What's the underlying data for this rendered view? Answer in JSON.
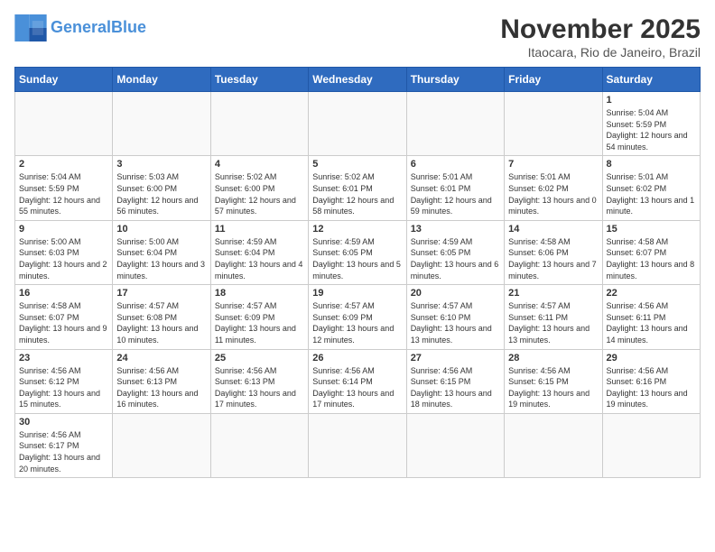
{
  "logo": {
    "text_general": "General",
    "text_blue": "Blue"
  },
  "calendar": {
    "title": "November 2025",
    "subtitle": "Itaocara, Rio de Janeiro, Brazil",
    "headers": [
      "Sunday",
      "Monday",
      "Tuesday",
      "Wednesday",
      "Thursday",
      "Friday",
      "Saturday"
    ],
    "days": [
      {
        "num": "",
        "info": ""
      },
      {
        "num": "",
        "info": ""
      },
      {
        "num": "",
        "info": ""
      },
      {
        "num": "",
        "info": ""
      },
      {
        "num": "",
        "info": ""
      },
      {
        "num": "",
        "info": ""
      },
      {
        "num": "1",
        "info": "Sunrise: 5:04 AM\nSunset: 5:59 PM\nDaylight: 12 hours and 54 minutes."
      },
      {
        "num": "2",
        "info": "Sunrise: 5:04 AM\nSunset: 5:59 PM\nDaylight: 12 hours and 55 minutes."
      },
      {
        "num": "3",
        "info": "Sunrise: 5:03 AM\nSunset: 6:00 PM\nDaylight: 12 hours and 56 minutes."
      },
      {
        "num": "4",
        "info": "Sunrise: 5:02 AM\nSunset: 6:00 PM\nDaylight: 12 hours and 57 minutes."
      },
      {
        "num": "5",
        "info": "Sunrise: 5:02 AM\nSunset: 6:01 PM\nDaylight: 12 hours and 58 minutes."
      },
      {
        "num": "6",
        "info": "Sunrise: 5:01 AM\nSunset: 6:01 PM\nDaylight: 12 hours and 59 minutes."
      },
      {
        "num": "7",
        "info": "Sunrise: 5:01 AM\nSunset: 6:02 PM\nDaylight: 13 hours and 0 minutes."
      },
      {
        "num": "8",
        "info": "Sunrise: 5:01 AM\nSunset: 6:02 PM\nDaylight: 13 hours and 1 minute."
      },
      {
        "num": "9",
        "info": "Sunrise: 5:00 AM\nSunset: 6:03 PM\nDaylight: 13 hours and 2 minutes."
      },
      {
        "num": "10",
        "info": "Sunrise: 5:00 AM\nSunset: 6:04 PM\nDaylight: 13 hours and 3 minutes."
      },
      {
        "num": "11",
        "info": "Sunrise: 4:59 AM\nSunset: 6:04 PM\nDaylight: 13 hours and 4 minutes."
      },
      {
        "num": "12",
        "info": "Sunrise: 4:59 AM\nSunset: 6:05 PM\nDaylight: 13 hours and 5 minutes."
      },
      {
        "num": "13",
        "info": "Sunrise: 4:59 AM\nSunset: 6:05 PM\nDaylight: 13 hours and 6 minutes."
      },
      {
        "num": "14",
        "info": "Sunrise: 4:58 AM\nSunset: 6:06 PM\nDaylight: 13 hours and 7 minutes."
      },
      {
        "num": "15",
        "info": "Sunrise: 4:58 AM\nSunset: 6:07 PM\nDaylight: 13 hours and 8 minutes."
      },
      {
        "num": "16",
        "info": "Sunrise: 4:58 AM\nSunset: 6:07 PM\nDaylight: 13 hours and 9 minutes."
      },
      {
        "num": "17",
        "info": "Sunrise: 4:57 AM\nSunset: 6:08 PM\nDaylight: 13 hours and 10 minutes."
      },
      {
        "num": "18",
        "info": "Sunrise: 4:57 AM\nSunset: 6:09 PM\nDaylight: 13 hours and 11 minutes."
      },
      {
        "num": "19",
        "info": "Sunrise: 4:57 AM\nSunset: 6:09 PM\nDaylight: 13 hours and 12 minutes."
      },
      {
        "num": "20",
        "info": "Sunrise: 4:57 AM\nSunset: 6:10 PM\nDaylight: 13 hours and 13 minutes."
      },
      {
        "num": "21",
        "info": "Sunrise: 4:57 AM\nSunset: 6:11 PM\nDaylight: 13 hours and 13 minutes."
      },
      {
        "num": "22",
        "info": "Sunrise: 4:56 AM\nSunset: 6:11 PM\nDaylight: 13 hours and 14 minutes."
      },
      {
        "num": "23",
        "info": "Sunrise: 4:56 AM\nSunset: 6:12 PM\nDaylight: 13 hours and 15 minutes."
      },
      {
        "num": "24",
        "info": "Sunrise: 4:56 AM\nSunset: 6:13 PM\nDaylight: 13 hours and 16 minutes."
      },
      {
        "num": "25",
        "info": "Sunrise: 4:56 AM\nSunset: 6:13 PM\nDaylight: 13 hours and 17 minutes."
      },
      {
        "num": "26",
        "info": "Sunrise: 4:56 AM\nSunset: 6:14 PM\nDaylight: 13 hours and 17 minutes."
      },
      {
        "num": "27",
        "info": "Sunrise: 4:56 AM\nSunset: 6:15 PM\nDaylight: 13 hours and 18 minutes."
      },
      {
        "num": "28",
        "info": "Sunrise: 4:56 AM\nSunset: 6:15 PM\nDaylight: 13 hours and 19 minutes."
      },
      {
        "num": "29",
        "info": "Sunrise: 4:56 AM\nSunset: 6:16 PM\nDaylight: 13 hours and 19 minutes."
      },
      {
        "num": "30",
        "info": "Sunrise: 4:56 AM\nSunset: 6:17 PM\nDaylight: 13 hours and 20 minutes."
      },
      {
        "num": "",
        "info": ""
      },
      {
        "num": "",
        "info": ""
      },
      {
        "num": "",
        "info": ""
      },
      {
        "num": "",
        "info": ""
      },
      {
        "num": "",
        "info": ""
      },
      {
        "num": "",
        "info": ""
      }
    ]
  }
}
